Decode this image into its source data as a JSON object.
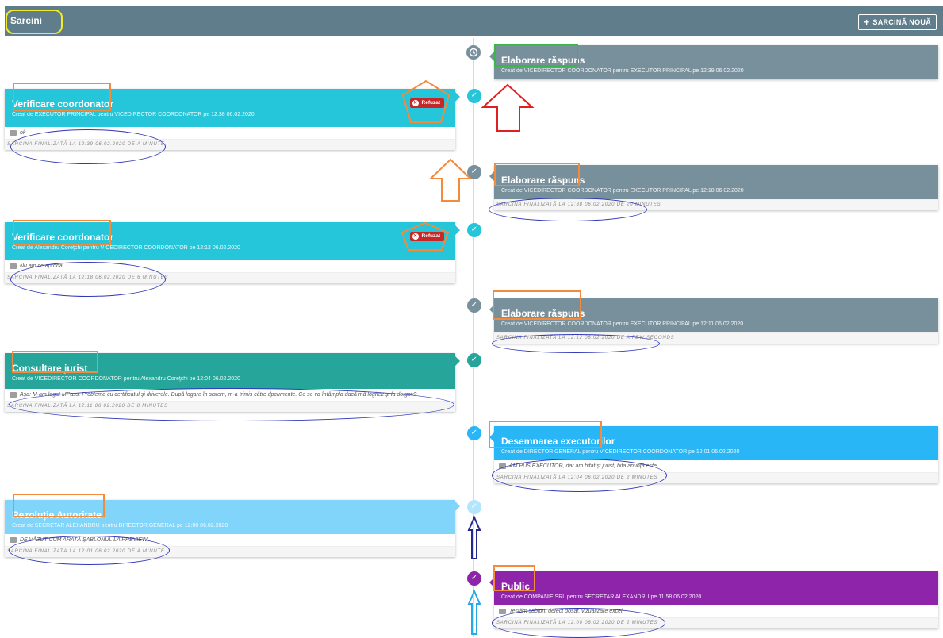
{
  "header": {
    "title": "Sarcini",
    "new_task_label": "SARCINĂ NOUĂ",
    "background": "#607d8b"
  },
  "badge_refused": "Refuzat",
  "tasks": [
    {
      "title": "Elaborare răspuns",
      "meta": "Creat de VICEDIRECTOR COORDONATOR pentru EXECUTOR PRINCIPAL pe 12:39 06.02.2020",
      "comment": "",
      "footer": "",
      "color": "#78909c",
      "status_icon": "clock-icon"
    },
    {
      "title": "Verificare coordonator",
      "meta": "Creat de EXECUTOR PRINCIPAL pentru VICEDIRECTOR COORDONATOR pe 12:38 06.02.2020",
      "comment": "ok",
      "footer": "SARCINA FINALIZATĂ LA 12:39 06.02.2020 DE A MINUTE",
      "color": "#26c6da",
      "status_icon": "check-icon"
    },
    {
      "title": "Elaborare răspuns",
      "meta": "Creat de VICEDIRECTOR COORDONATOR pentru EXECUTOR PRINCIPAL pe 12:18 06.02.2020",
      "comment": "",
      "footer": "SARCINA FINALIZATĂ LA 12:38 06.02.2020 DE 20 MINUTES",
      "color": "#78909c",
      "status_icon": "check-icon"
    },
    {
      "title": "Verificare coordonator",
      "meta": "Creat de Alexandru Coreţchi pentru VICEDIRECTOR COORDONATOR pe 12:12 06.02.2020",
      "comment": "Nu am ce aproba",
      "footer": "SARCINA FINALIZATĂ LA 12:18 06.02.2020 DE 6 MINUTES",
      "color": "#26c6da",
      "status_icon": "check-icon"
    },
    {
      "title": "Elaborare răspuns",
      "meta": "Creat de VICEDIRECTOR COORDONATOR pentru EXECUTOR PRINCIPAL pe 12:11 06.02.2020",
      "comment": "",
      "footer": "SARCINA FINALIZATĂ LA 12:12 06.02.2020 DE A FEW SECONDS",
      "color": "#78909c",
      "status_icon": "check-icon"
    },
    {
      "title": "Consultare jurist",
      "meta": "Creat de VICEDIRECTOR COORDONATOR pentru Alexandru Coreţchi pe 12:04 06.02.2020",
      "comment": "Așa: M-am logat MPass. Problema cu certificatul și driverele. După logare în sistem, m-a trimis către dpcumente. Ce se va întâmpla dacă mă loghez și la dotgov?",
      "footer": "SARCINA FINALIZATĂ LA 12:11 06.02.2020 DE 8 MINUTES",
      "color": "#26a69a",
      "status_icon": "check-icon"
    },
    {
      "title": "Desemnarea executorilor",
      "meta": "Creat de DIRECTOR GENERAL pentru VICEDIRECTOR COORDONATOR pe 12:01 06.02.2020",
      "comment": "AM PUS EXECUTOR, dar am bifat și jurist, bifa anunță este",
      "footer": "SARCINA FINALIZATĂ LA 12:04 06.02.2020 DE 2 MINUTES",
      "color": "#29b6f6",
      "status_icon": "check-icon"
    },
    {
      "title": "Rezoluție Autoritate",
      "meta": "Creat de SECRETAR ALEXANDRU pentru DIRECTOR GENERAL pe 12:00 06.02.2020",
      "comment": "DE VĂZUT CUM ARATĂ ȘABLONUL LA PREVIEW",
      "footer": "SARCINA FINALIZATĂ LA 12:01 06.02.2020 DE A MINUTE",
      "color": "#81d4fa",
      "status_icon": "check-icon"
    },
    {
      "title": "Public",
      "meta": "Creat de COMPANIE SRL pentru SECRETAR ALEXANDRU pe 11:58 06.02.2020",
      "comment": "Testăm șablon, defect dosar, vizualizare excel.",
      "footer": "SARCINA FINALIZATĂ LA 12:00 06.02.2020 DE 2 MINUTES",
      "color": "#8e24aa",
      "status_icon": "check-icon"
    }
  ]
}
